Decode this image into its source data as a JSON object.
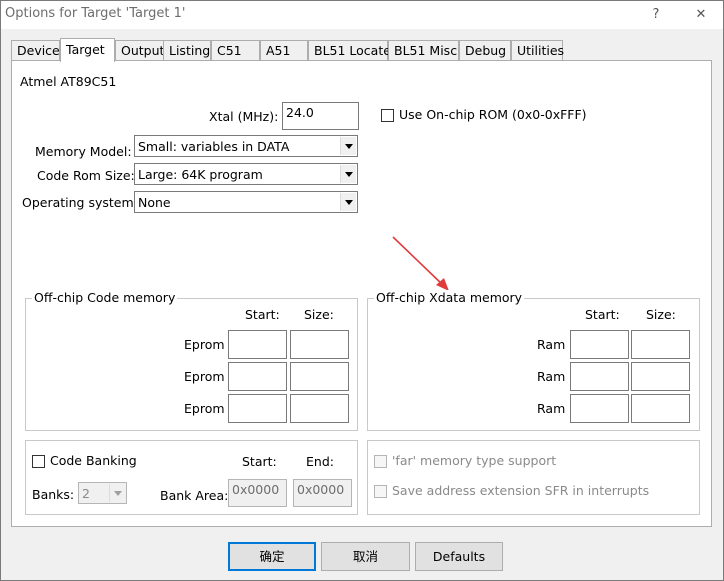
{
  "window": {
    "title": "Options for Target 'Target 1'",
    "help_label": "?",
    "close_label": "✕"
  },
  "tabs": [
    {
      "label": "Device"
    },
    {
      "label": "Target"
    },
    {
      "label": "Output"
    },
    {
      "label": "Listing"
    },
    {
      "label": "C51"
    },
    {
      "label": "A51"
    },
    {
      "label": "BL51 Locate"
    },
    {
      "label": "BL51 Misc"
    },
    {
      "label": "Debug"
    },
    {
      "label": "Utilities"
    }
  ],
  "active_tab": "Target",
  "target": {
    "device_name": "Atmel AT89C51",
    "xtal_label": "Xtal (MHz):",
    "xtal_value": "24.0",
    "onchip_rom_label": "Use On-chip ROM (0x0-0xFFF)",
    "memory_model_label": "Memory Model:",
    "memory_model_value": "Small: variables in DATA",
    "code_rom_label": "Code Rom Size:",
    "code_rom_value": "Large: 64K program",
    "os_label": "Operating system:",
    "os_value": "None"
  },
  "offchip_code": {
    "title": "Off-chip Code memory",
    "start_header": "Start:",
    "size_header": "Size:",
    "rows": [
      {
        "label": "Eprom"
      },
      {
        "label": "Eprom"
      },
      {
        "label": "Eprom"
      }
    ]
  },
  "offchip_xdata": {
    "title": "Off-chip Xdata memory",
    "start_header": "Start:",
    "size_header": "Size:",
    "rows": [
      {
        "label": "Ram"
      },
      {
        "label": "Ram"
      },
      {
        "label": "Ram"
      }
    ]
  },
  "banking": {
    "code_banking_label": "Code Banking",
    "start_header": "Start:",
    "end_header": "End:",
    "banks_label": "Banks:",
    "banks_value": "2",
    "bank_area_label": "Bank Area:",
    "bank_start_value": "0x0000",
    "bank_end_value": "0x0000"
  },
  "extras": {
    "far_memory_label": "'far' memory type support",
    "save_sfr_label": "Save address extension SFR in interrupts"
  },
  "buttons": {
    "ok_label": "确定",
    "cancel_label": "取消",
    "defaults_label": "Defaults"
  },
  "colors": {
    "annotation_arrow": "#e03c3c",
    "focus_blue": "#0078d7"
  }
}
